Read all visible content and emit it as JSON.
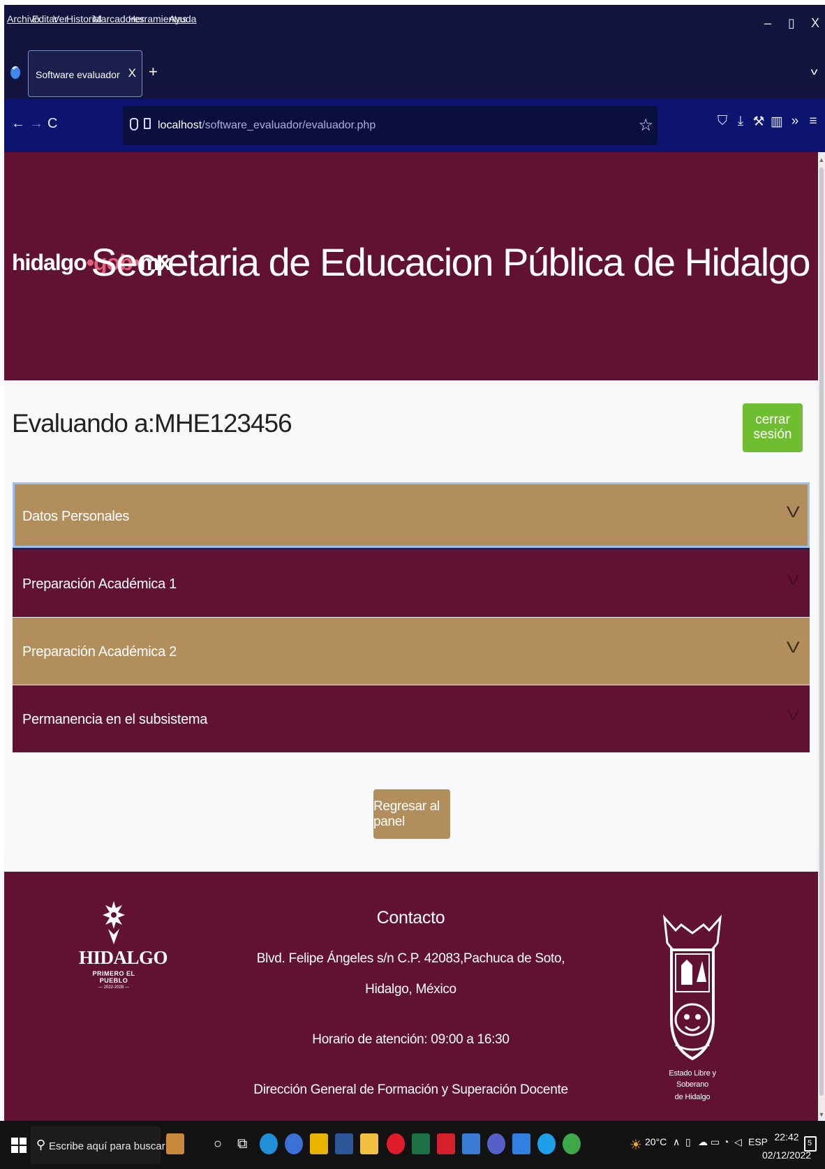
{
  "browser": {
    "menu": [
      "Archivo",
      "Editar",
      "Ver",
      "Historial",
      "Marcadores",
      "Herramientas",
      "Ayuda"
    ],
    "window_controls": {
      "minimize": "–",
      "restore": "▯",
      "close": "X"
    },
    "tab": {
      "title": "Software evaluador",
      "close": "X"
    },
    "new_tab": "+",
    "tab_list": "v",
    "nav": {
      "back": "←",
      "forward": "→",
      "reload": "C"
    },
    "url": {
      "host": "localhost",
      "path": "/software_evaluador/evaluador.php"
    },
    "bookmark_star": "☆",
    "toolbar_icons": [
      "pocket-icon",
      "download-icon",
      "tools-icon",
      "library-icon",
      "overflow-icon",
      "menu-icon"
    ]
  },
  "header": {
    "brand": {
      "part1": "hidalgo",
      "sep1": "•",
      "part2": "gob",
      "sep2": "•",
      "part3": "mx"
    },
    "title": "Secretaria de Educacion Pública de Hidalgo"
  },
  "main": {
    "evaluating_label": "Evaluando a:",
    "evaluating_id": "MHE123456",
    "logout_label": "cerrar sesión",
    "accordion": [
      {
        "label": "Datos Personales",
        "style": "gold",
        "active": true
      },
      {
        "label": "Preparación Académica 1",
        "style": "wine",
        "active": false
      },
      {
        "label": "Preparación Académica 2",
        "style": "gold",
        "active": false
      },
      {
        "label": "Permanencia en el subsistema",
        "style": "wine",
        "active": false
      }
    ],
    "chevron": "V",
    "back_label": "Regresar al panel"
  },
  "footer": {
    "logo": {
      "name": "HIDALGO",
      "sub": "PRIMERO EL PUEBLO",
      "years": "— 2022-2028 —"
    },
    "contact_title": "Contacto",
    "address_line1": "Blvd. Felipe Ángeles s/n C.P. 42083,Pachuca de Soto,",
    "address_line2": "Hidalgo, México",
    "hours": "Horario de atención: 09:00 a 16:30",
    "department": "Dirección General de Formación y Superación Docente",
    "shield_text_line1": "Estado Libre y Soberano",
    "shield_text_line2": "de Hidalgo"
  },
  "taskbar": {
    "search_placeholder": "Escribe aquí para buscar",
    "weather": "20°C",
    "language": "ESP",
    "time": "22:42",
    "date": "02/12/2022",
    "notification_count": "5",
    "colors": {
      "accent_gold": "#b38e5d",
      "accent_wine": "#611232",
      "logout_green": "#6fbe31"
    }
  }
}
